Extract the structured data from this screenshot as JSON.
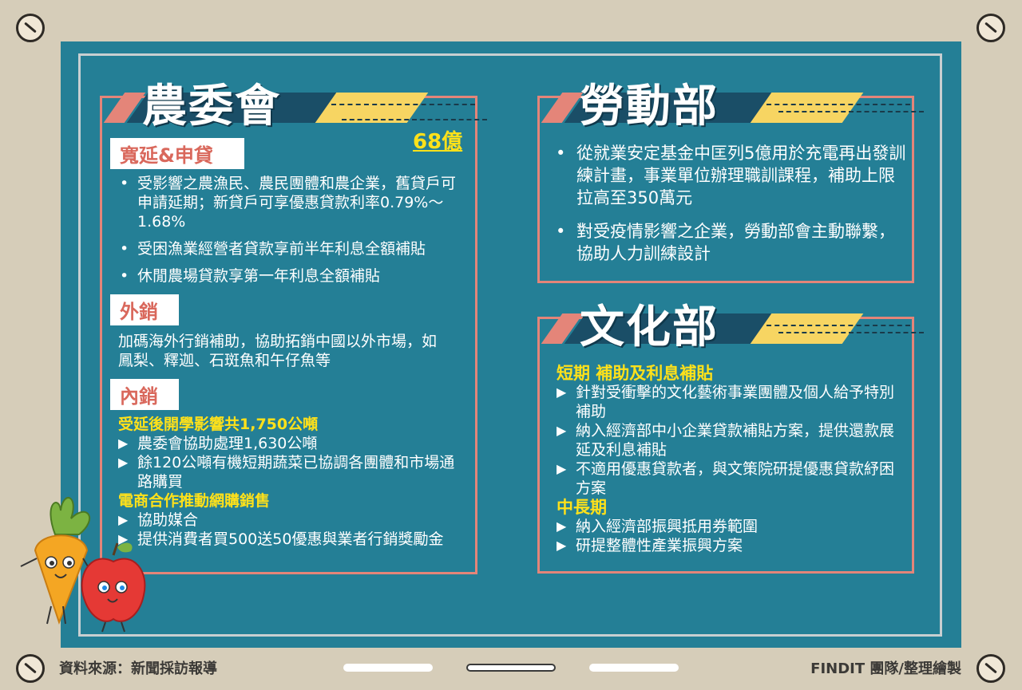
{
  "coa": {
    "title": "農委會",
    "amount": "68億",
    "s1_label": "寬延&申貸",
    "s1_items": [
      "受影響之農漁民、農民團體和農企業，舊貸戶可申請延期；新貸戶可享優惠貸款利率0.79%～1.68%",
      "受困漁業經營者貸款享前半年利息全額補貼",
      "休閒農場貸款享第一年利息全額補貼"
    ],
    "s2_label": "外銷",
    "s2_text": "加碼海外行銷補助，協助拓銷中國以外市場，如鳳梨、釋迦、石斑魚和午仔魚等",
    "s3_label": "內銷",
    "s3_head1": "受延後開學影響共1,750公噸",
    "s3_items1": [
      "農委會協助處理1,630公噸",
      "餘120公噸有機短期蔬菜已協調各團體和市場通路購買"
    ],
    "s3_head2": "電商合作推動網購銷售",
    "s3_items2": [
      "協助媒合",
      "提供消費者買500送50優惠與業者行銷獎勵金"
    ]
  },
  "mol": {
    "title": "勞動部",
    "items": [
      "從就業安定基金中匡列5億用於充電再出發訓練計畫，事業單位辦理職訓課程，補助上限拉高至350萬元",
      "對受疫情影響之企業，勞動部會主動聯繫，協助人力訓練設計"
    ]
  },
  "moc": {
    "title": "文化部",
    "head1": "短期 補助及利息補貼",
    "items1": [
      "針對受衝擊的文化藝術事業團體及個人給予特別補助",
      "納入經濟部中小企業貸款補貼方案，提供還款展延及利息補貼",
      "不適用優惠貸款者，與文策院研提優惠貸款紓困方案"
    ],
    "head2": "中長期",
    "items2": [
      "納入經濟部振興抵用券範圍",
      "研提整體性產業振興方案"
    ]
  },
  "footer": {
    "source": "資料來源：新聞採訪報導",
    "credit": "FINDIT 團隊/整理繪製"
  },
  "colors": {
    "background": "#d6cdb9",
    "board": "#247f96",
    "accent_red": "#e48579",
    "accent_yellow": "#f7d562",
    "highlight_yellow": "#ffe11a",
    "title_bar": "#1a4e67"
  },
  "icons": [
    "screw-icon",
    "carrot-mascot-icon",
    "apple-mascot-icon"
  ]
}
